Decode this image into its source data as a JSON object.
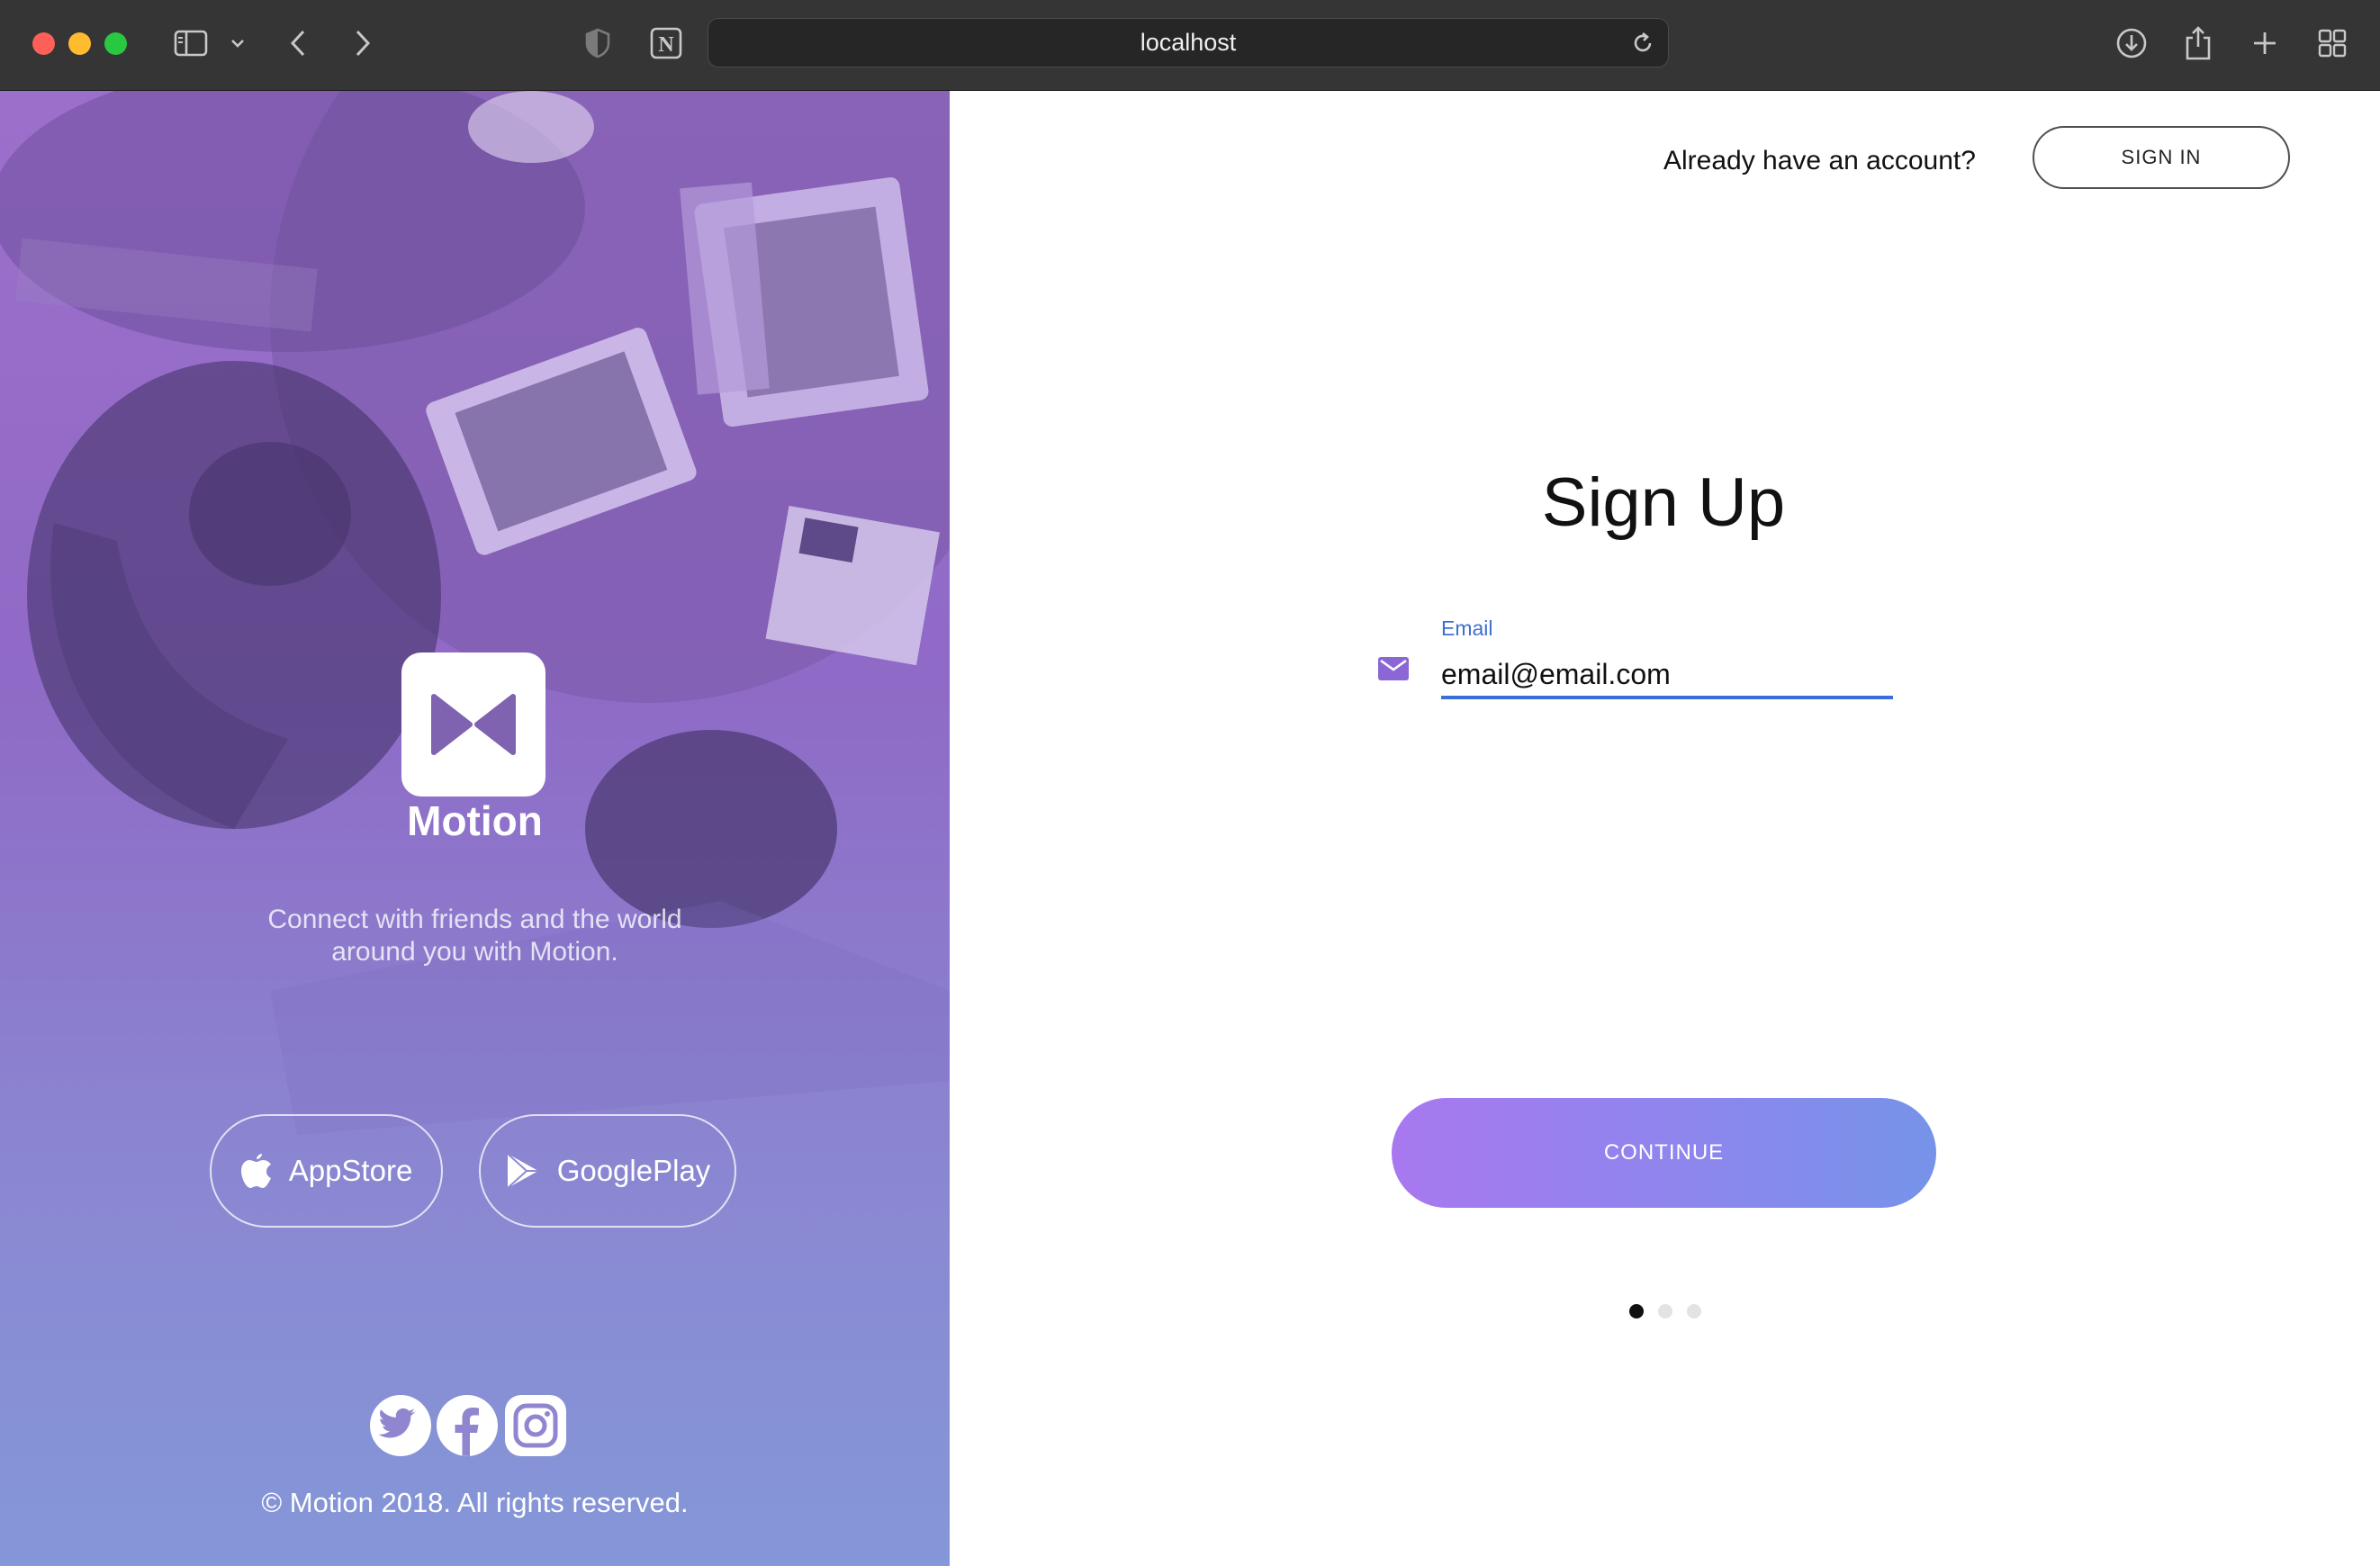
{
  "browser": {
    "url": "localhost"
  },
  "hero": {
    "brand": "Motion",
    "tagline": "Connect with friends and the world around you with Motion.",
    "store_buttons": [
      {
        "label": "AppStore",
        "icon": "apple-icon"
      },
      {
        "label": "GooglePlay",
        "icon": "google-play-icon"
      }
    ],
    "social_icons": [
      "twitter-icon",
      "facebook-icon",
      "instagram-icon"
    ],
    "copyright": "© Motion 2018. All rights reserved."
  },
  "header": {
    "prompt": "Already have an account?",
    "signin_label": "SIGN IN"
  },
  "form": {
    "title": "Sign Up",
    "email_label": "Email",
    "email_value": "email@email.com",
    "continue_label": "CONTINUE",
    "step": {
      "current": 1,
      "total": 3
    }
  },
  "colors": {
    "accent_blue": "#3a6fd9",
    "gradient_start": "#a878ef",
    "gradient_end": "#7693e9",
    "hero_purple": "#9c6fcb"
  }
}
